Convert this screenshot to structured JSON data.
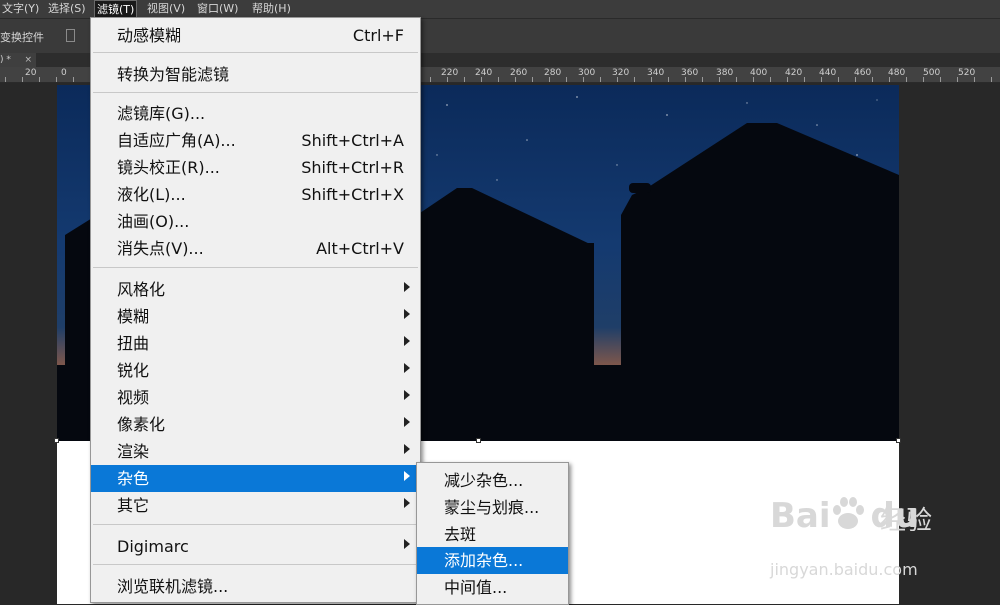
{
  "menubar": {
    "items": [
      {
        "label": "文字(Y)"
      },
      {
        "label": "选择(S)"
      },
      {
        "label": "滤镜(T)"
      },
      {
        "label": "视图(V)"
      },
      {
        "label": "窗口(W)"
      },
      {
        "label": "帮助(H)"
      }
    ]
  },
  "options_bar": {
    "label": "变换控件"
  },
  "document_tab": {
    "title": ") *",
    "close": "×"
  },
  "ruler": {
    "labels": [
      "20",
      "0",
      "220",
      "240",
      "260",
      "280",
      "300",
      "320",
      "340",
      "360",
      "380",
      "400",
      "420",
      "440",
      "460",
      "480",
      "500",
      "520"
    ]
  },
  "filter_menu": {
    "items": [
      {
        "label": "动感模糊",
        "shortcut": "Ctrl+F"
      },
      {
        "label": "转换为智能滤镜"
      },
      {
        "label": "滤镜库(G)..."
      },
      {
        "label": "自适应广角(A)...",
        "shortcut": "Shift+Ctrl+A"
      },
      {
        "label": "镜头校正(R)...",
        "shortcut": "Shift+Ctrl+R"
      },
      {
        "label": "液化(L)...",
        "shortcut": "Shift+Ctrl+X"
      },
      {
        "label": "油画(O)..."
      },
      {
        "label": "消失点(V)...",
        "shortcut": "Alt+Ctrl+V"
      },
      {
        "label": "风格化",
        "submenu": true
      },
      {
        "label": "模糊",
        "submenu": true
      },
      {
        "label": "扭曲",
        "submenu": true
      },
      {
        "label": "锐化",
        "submenu": true
      },
      {
        "label": "视频",
        "submenu": true
      },
      {
        "label": "像素化",
        "submenu": true
      },
      {
        "label": "渲染",
        "submenu": true
      },
      {
        "label": "杂色",
        "submenu": true,
        "highlighted": true
      },
      {
        "label": "其它",
        "submenu": true
      },
      {
        "label": "Digimarc",
        "submenu": true
      },
      {
        "label": "浏览联机滤镜..."
      }
    ]
  },
  "noise_submenu": {
    "items": [
      {
        "label": "减少杂色..."
      },
      {
        "label": "蒙尘与划痕..."
      },
      {
        "label": "去斑"
      },
      {
        "label": "添加杂色...",
        "highlighted": true
      },
      {
        "label": "中间值..."
      }
    ]
  },
  "watermark": {
    "brand": "Bai",
    "brand2": "du",
    "cn": "经验",
    "url": "jingyan.baidu.com"
  },
  "colors": {
    "highlight": "#0a78d7",
    "menu_bg": "#f0f0f0",
    "app_bg": "#282828"
  }
}
